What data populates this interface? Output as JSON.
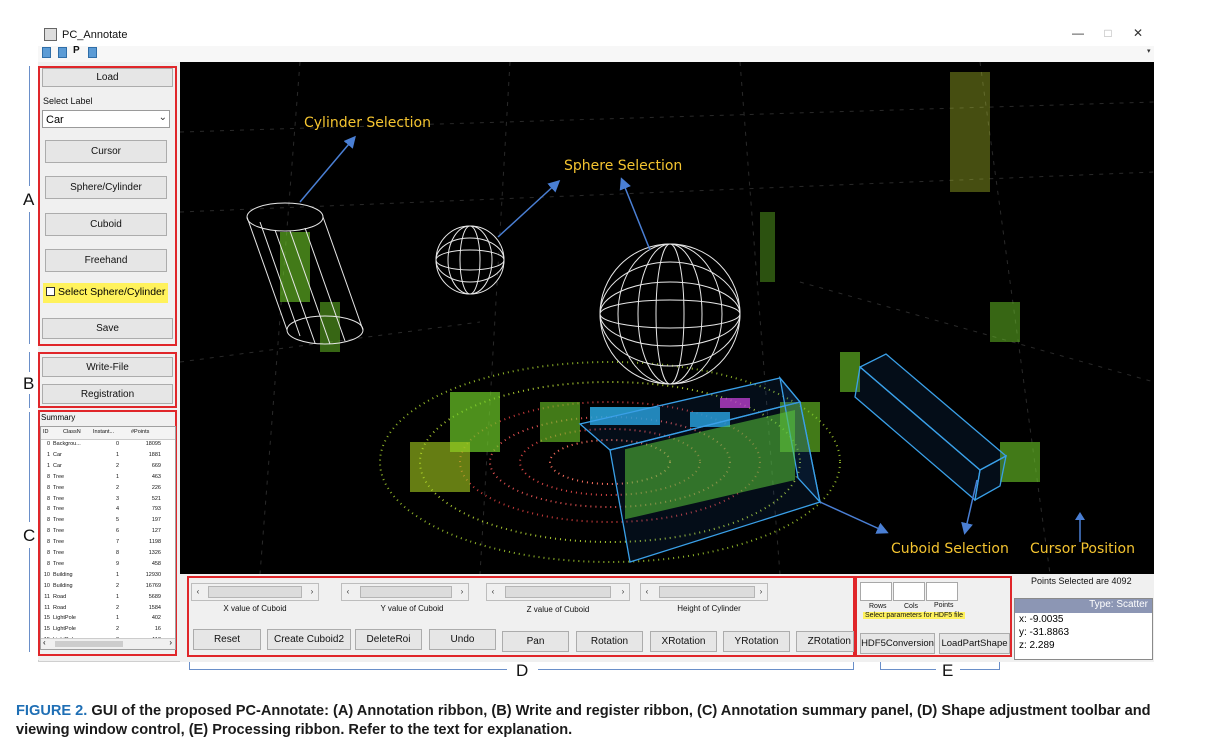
{
  "window": {
    "title": "PC_Annotate",
    "minimize": "—",
    "maximize": "□",
    "close": "✕",
    "toolbar_p": "P"
  },
  "ribbon_a": {
    "letter": "A",
    "load_label": "Load",
    "select_label_caption": "Select Label",
    "selected_label": "Car",
    "cursor_label": "Cursor",
    "sphere_cylinder_label": "Sphere/Cylinder",
    "cuboid_label": "Cuboid",
    "freehand_label": "Freehand",
    "select_sphere_cylinder_label": "Select Sphere/Cylinder",
    "save_label": "Save"
  },
  "ribbon_b": {
    "letter": "B",
    "write_file_label": "Write-File",
    "registration_label": "Registration"
  },
  "summary": {
    "letter": "C",
    "title": "Summary",
    "columns": [
      "ID",
      "ClassN",
      "Instant...",
      "#Points"
    ],
    "rows": [
      [
        "0",
        "Backgrou...",
        "0",
        "18095"
      ],
      [
        "1",
        "Car",
        "1",
        "1881"
      ],
      [
        "1",
        "Car",
        "2",
        "669"
      ],
      [
        "8",
        "Tree",
        "1",
        "463"
      ],
      [
        "8",
        "Tree",
        "2",
        "226"
      ],
      [
        "8",
        "Tree",
        "3",
        "521"
      ],
      [
        "8",
        "Tree",
        "4",
        "793"
      ],
      [
        "8",
        "Tree",
        "5",
        "197"
      ],
      [
        "8",
        "Tree",
        "6",
        "127"
      ],
      [
        "8",
        "Tree",
        "7",
        "1198"
      ],
      [
        "8",
        "Tree",
        "8",
        "1326"
      ],
      [
        "8",
        "Tree",
        "9",
        "458"
      ],
      [
        "10",
        "Building",
        "1",
        "12930"
      ],
      [
        "10",
        "Building",
        "2",
        "16769"
      ],
      [
        "11",
        "Road",
        "1",
        "5689"
      ],
      [
        "11",
        "Road",
        "2",
        "1584"
      ],
      [
        "15",
        "LightPole",
        "1",
        "402"
      ],
      [
        "15",
        "LightPole",
        "2",
        "16"
      ],
      [
        "15",
        "LightPole",
        "3",
        "113"
      ]
    ]
  },
  "viewer": {
    "cylinder_selection": "Cylinder  Selection",
    "sphere_selection": "Sphere  Selection",
    "cuboid_selection": "Cuboid Selection",
    "cursor_position": "Cursor Position"
  },
  "toolbar_d": {
    "letter": "D",
    "slider_x_label": "X value of Cuboid",
    "slider_y_label": "Y value of Cuboid",
    "slider_z_label": "Z value of Cuboid",
    "slider_h_label": "Height of Cylinder",
    "reset_label": "Reset",
    "create_cuboid_label": "Create Cuboid2",
    "delete_roi_label": "DeleteRoi",
    "undo_label": "Undo",
    "pan_label": "Pan",
    "rotation_label": "Rotation",
    "xrotation_label": "XRotation",
    "yrotation_label": "YRotation",
    "zrotation_label": "ZRotation"
  },
  "ribbon_e": {
    "letter": "E",
    "rows_label": "Rows",
    "cols_label": "Cols",
    "points_label": "Points",
    "hint": "Select parameters for HDF5 file",
    "hdf5_label": "HDF5Conversion",
    "loadpart_label": "LoadPartShape"
  },
  "status": {
    "points_selected": "Points Selected are 4092",
    "type_label": "Type: Scatter",
    "x": "x: -9.0035",
    "y": "y: -31.8863",
    "z": "z: 2.289"
  },
  "caption": {
    "label": "FIGURE 2.",
    "text": "GUI of the proposed PC-Annotate: (A) Annotation ribbon, (B) Write and register ribbon, (C) Annotation summary panel, (D)  Shape adjustment toolbar and viewing window control, (E) Processing ribbon. Refer to the text for explanation."
  },
  "colors": {
    "accent_red": "#e0262a",
    "annotation_yellow": "#f4c430",
    "arrow_blue": "#4a7fd4",
    "type_bar": "#8c96b4"
  }
}
